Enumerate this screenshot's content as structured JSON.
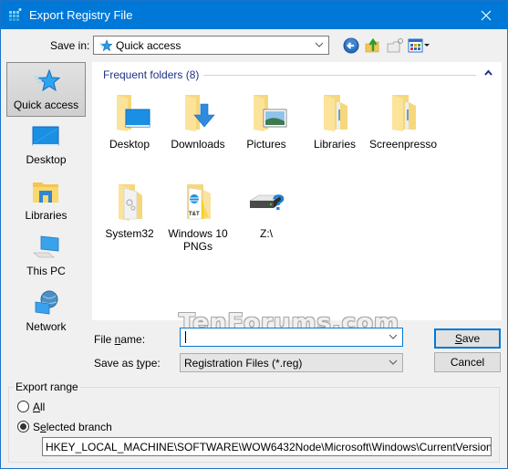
{
  "window": {
    "title": "Export Registry File",
    "close_label": "Close"
  },
  "toolbar": {
    "save_in_label": "Save in:",
    "save_in_value": "Quick access",
    "buttons": [
      "back",
      "up-one-level",
      "create-new-folder",
      "view-menu"
    ]
  },
  "places": [
    {
      "label": "Quick access",
      "icon": "star-icon",
      "selected": true
    },
    {
      "label": "Desktop",
      "icon": "desktop-icon",
      "selected": false
    },
    {
      "label": "Libraries",
      "icon": "libraries-icon",
      "selected": false
    },
    {
      "label": "This PC",
      "icon": "computer-icon",
      "selected": false
    },
    {
      "label": "Network",
      "icon": "network-icon",
      "selected": false
    }
  ],
  "content": {
    "group_header": "Frequent folders (8)",
    "items": [
      {
        "label": "Desktop",
        "icon": "folder-desktop-icon"
      },
      {
        "label": "Downloads",
        "icon": "folder-downloads-icon"
      },
      {
        "label": "Pictures",
        "icon": "folder-pictures-icon"
      },
      {
        "label": "Libraries",
        "icon": "folder-icon"
      },
      {
        "label": "Screenpresso",
        "icon": "folder-icon"
      },
      {
        "label": "System32",
        "icon": "folder-system-icon"
      },
      {
        "label": "Windows 10 PNGs",
        "icon": "folder-image-icon"
      },
      {
        "label": "Z:\\",
        "icon": "drive-unknown-icon"
      }
    ]
  },
  "watermark": "TenForums.com",
  "form": {
    "file_name_label_pre": "File ",
    "file_name_label_u": "n",
    "file_name_label_post": "ame:",
    "file_name_value": "",
    "save_type_label_pre": "Save as ",
    "save_type_label_u": "t",
    "save_type_label_post": "ype:",
    "save_type_value": "Registration Files (*.reg)",
    "save_button_u": "S",
    "save_button_rest": "ave",
    "cancel_button": "Cancel"
  },
  "export_range": {
    "title": "Export range",
    "all_u": "A",
    "all_rest": "ll",
    "selected_pre": "S",
    "selected_u": "e",
    "selected_post": "lected branch",
    "selected": "selected_branch",
    "branch_path": "HKEY_LOCAL_MACHINE\\SOFTWARE\\WOW6432Node\\Microsoft\\Windows\\CurrentVersion\\Explore"
  }
}
